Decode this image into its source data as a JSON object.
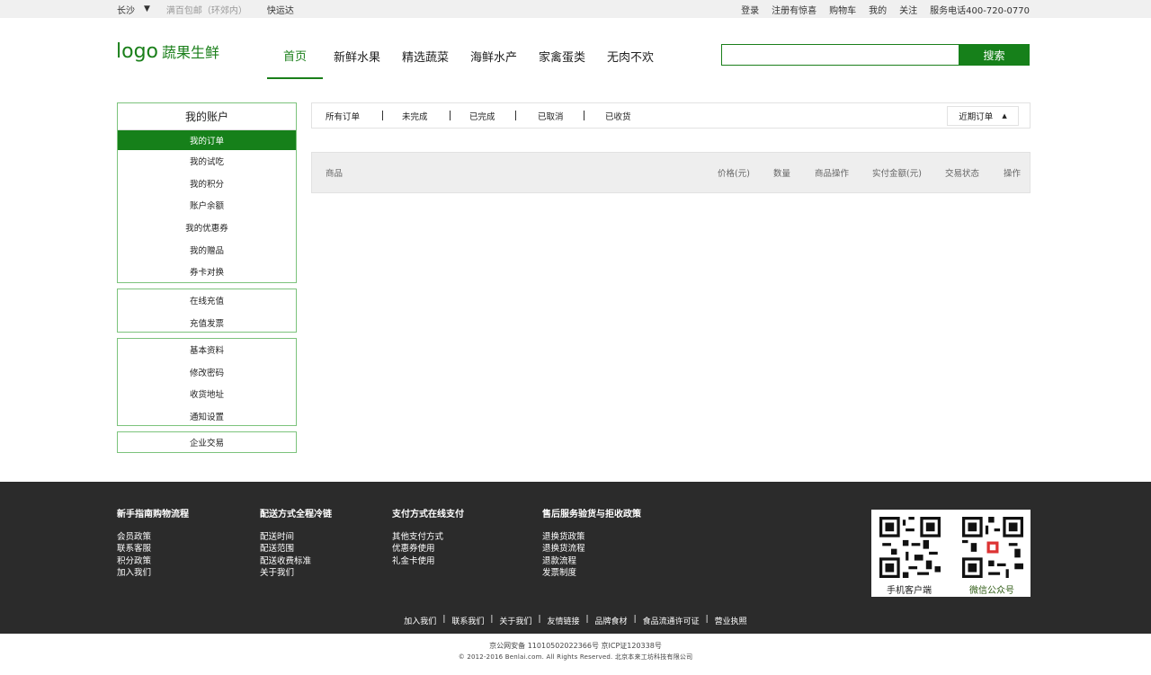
{
  "topbar": {
    "city": "长沙",
    "free_shipping": "满百包邮（环郊内）",
    "express": "快运达",
    "right_links": [
      "登录",
      "注册有惊喜",
      "购物车",
      "我的",
      "关注",
      "服务电话400-720-0770"
    ]
  },
  "header": {
    "logo_text": "logo",
    "brand": "蔬果生鲜",
    "nav": [
      "首页",
      "新鲜水果",
      "精选蔬菜",
      "海鲜水产",
      "家禽蛋类",
      "无肉不欢"
    ],
    "search_value": "",
    "search_button": "搜索"
  },
  "sidebar": {
    "title": "我的账户",
    "group1": [
      "我的订单",
      "我的试吃",
      "我的积分",
      "账户余额",
      "我的优惠券",
      "我的赠品",
      "券卡对换"
    ],
    "group2": [
      "在线充值",
      "充值发票"
    ],
    "group3": [
      "基本资料",
      "修改密码",
      "收货地址",
      "通知设置"
    ],
    "group4": [
      "企业交易"
    ]
  },
  "orders": {
    "tabs": [
      "所有订单",
      "未完成",
      "已完成",
      "已取消",
      "已收货"
    ],
    "period": "近期订单",
    "columns": [
      "商品",
      "价格(元)",
      "数量",
      "商品操作",
      "实付金额(元)",
      "交易状态",
      "操作"
    ]
  },
  "footer": {
    "columns": [
      {
        "title": "新手指南购物流程",
        "links": [
          "会员政策",
          "联系客服",
          "积分政策",
          "加入我们"
        ]
      },
      {
        "title": "配送方式全程冷链",
        "links": [
          "配送时间",
          "配送范围",
          "配送收费标准",
          "关于我们"
        ]
      },
      {
        "title": "支付方式在线支付",
        "links": [
          "其他支付方式",
          "优惠券使用",
          "礼金卡使用"
        ]
      },
      {
        "title": "售后服务验货与拒收政策",
        "links": [
          "退换货政策",
          "退换货流程",
          "退款流程",
          "发票制度"
        ]
      }
    ],
    "qr_app": "手机客户端",
    "qr_wechat": "微信公众号",
    "bottom_links": [
      "加入我们",
      "联系我们",
      "关于我们",
      "友情链接",
      "品牌食材",
      "食品流通许可证",
      "营业执照"
    ],
    "copyright_line1": "京公网安备 11010502022366号 京ICP证120338号",
    "copyright_line2": "© 2012-2016 Benlai.com. All Rights Reserved. 北京本来工坊科技有限公司"
  },
  "colors": {
    "accent": "#16801a",
    "footer_bg": "#2b2b2b",
    "topbar_bg": "#f0f0f0"
  }
}
